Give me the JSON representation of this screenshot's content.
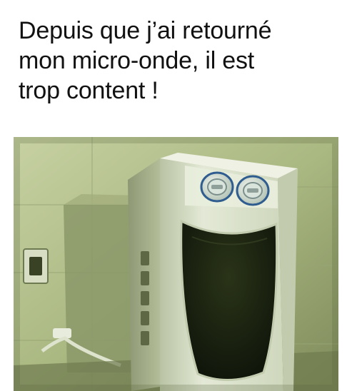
{
  "caption": {
    "lines": [
      "Depuis que j’ai retourné",
      "mon micro-onde, il est",
      "trop content !"
    ]
  },
  "photo": {
    "subject": "microwave-upside-down-smiling-face",
    "palette": {
      "wall": "#b5c08f",
      "wall_shadow": "#7f8c5c",
      "microwave_body": "#dfe6cf",
      "microwave_shade": "#b8c2a2",
      "door_window": "#1b2211",
      "knob": "#c9d7cc",
      "knob_blue": "#2f5d8f"
    }
  }
}
